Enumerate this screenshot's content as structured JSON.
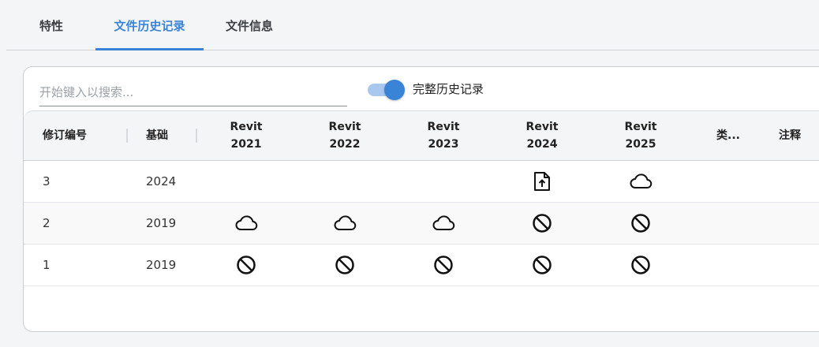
{
  "tabs": [
    {
      "label": "特性",
      "active": false
    },
    {
      "label": "文件历史记录",
      "active": true
    },
    {
      "label": "文件信息",
      "active": false
    }
  ],
  "search": {
    "placeholder": "开始键入以搜索...",
    "value": ""
  },
  "toggle": {
    "label": "完整历史记录",
    "on": true
  },
  "table": {
    "headers": {
      "revision": "修订编号",
      "base": "基础",
      "r2021": "Revit\n2021",
      "r2022": "Revit\n2022",
      "r2023": "Revit\n2023",
      "r2024": "Revit\n2024",
      "r2025": "Revit\n2025",
      "type": "类...",
      "notes": "注释"
    },
    "rows": [
      {
        "revision": "3",
        "base": "2024",
        "r2021": "",
        "r2022": "",
        "r2023": "",
        "r2024": "file-upload-icon",
        "r2025": "cloud-icon"
      },
      {
        "revision": "2",
        "base": "2019",
        "r2021": "cloud-icon",
        "r2022": "cloud-icon",
        "r2023": "cloud-icon",
        "r2024": "no-entry-icon",
        "r2025": "no-entry-icon"
      },
      {
        "revision": "1",
        "base": "2019",
        "r2021": "no-entry-icon",
        "r2022": "no-entry-icon",
        "r2023": "no-entry-icon",
        "r2024": "no-entry-icon",
        "r2025": "no-entry-icon"
      }
    ]
  },
  "colors": {
    "accent": "#3a84d8",
    "toggle_track": "#a8c8f0"
  }
}
